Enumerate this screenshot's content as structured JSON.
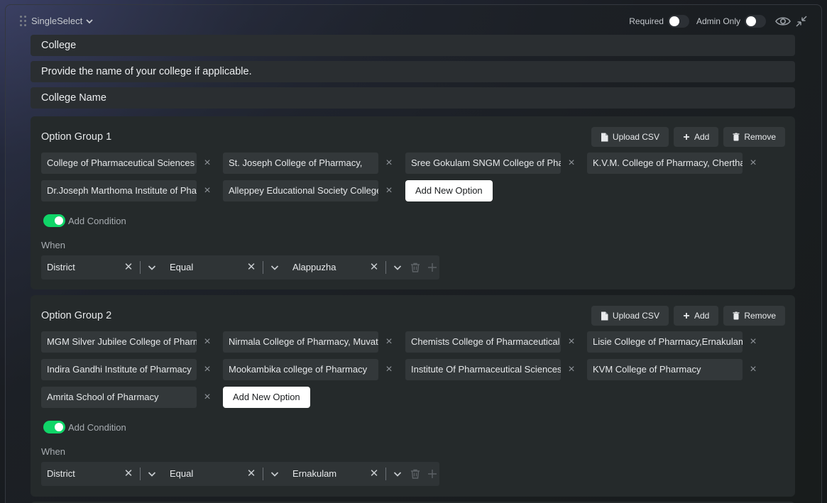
{
  "topbar": {
    "type_label": "SingleSelect",
    "required_label": "Required",
    "admin_only_label": "Admin Only",
    "required_on": false,
    "admin_only_on": false
  },
  "fields": {
    "label": "College",
    "description": "Provide the name of your college if applicable.",
    "placeholder": "College Name"
  },
  "group_actions": {
    "upload_csv": "Upload CSV",
    "add": "Add",
    "remove": "Remove"
  },
  "add_new_option_label": "Add New Option",
  "add_condition_label": "Add Condition",
  "when_label": "When",
  "groups": [
    {
      "title": "Option Group 1",
      "options": [
        "College of Pharmaceutical Sciences",
        "St. Joseph College of Pharmacy,",
        "Sree Gokulam SNGM College of Pharmacy",
        "K.V.M. College of Pharmacy, Cherthala",
        "Dr.Joseph Marthoma Institute of Pharmacy",
        "Alleppey Educational Society  College"
      ],
      "condition_enabled": true,
      "condition": {
        "field": "District",
        "operator": "Equal",
        "value": "Alappuzha"
      }
    },
    {
      "title": "Option Group 2",
      "options": [
        "MGM Silver Jubilee College of Pharmacy",
        "Nirmala College of Pharmacy, Muvattupuzha",
        "Chemists College of Pharmaceutical",
        "Lisie College of Pharmacy,Ernakulam",
        "Indira Gandhi Institute of Pharmacy",
        "Mookambika college of Pharmacy",
        "Institute Of Pharmaceutical Sciences",
        "KVM College of Pharmacy",
        "Amrita School of Pharmacy"
      ],
      "condition_enabled": true,
      "condition": {
        "field": "District",
        "operator": "Equal",
        "value": "Ernakulam"
      }
    }
  ]
}
